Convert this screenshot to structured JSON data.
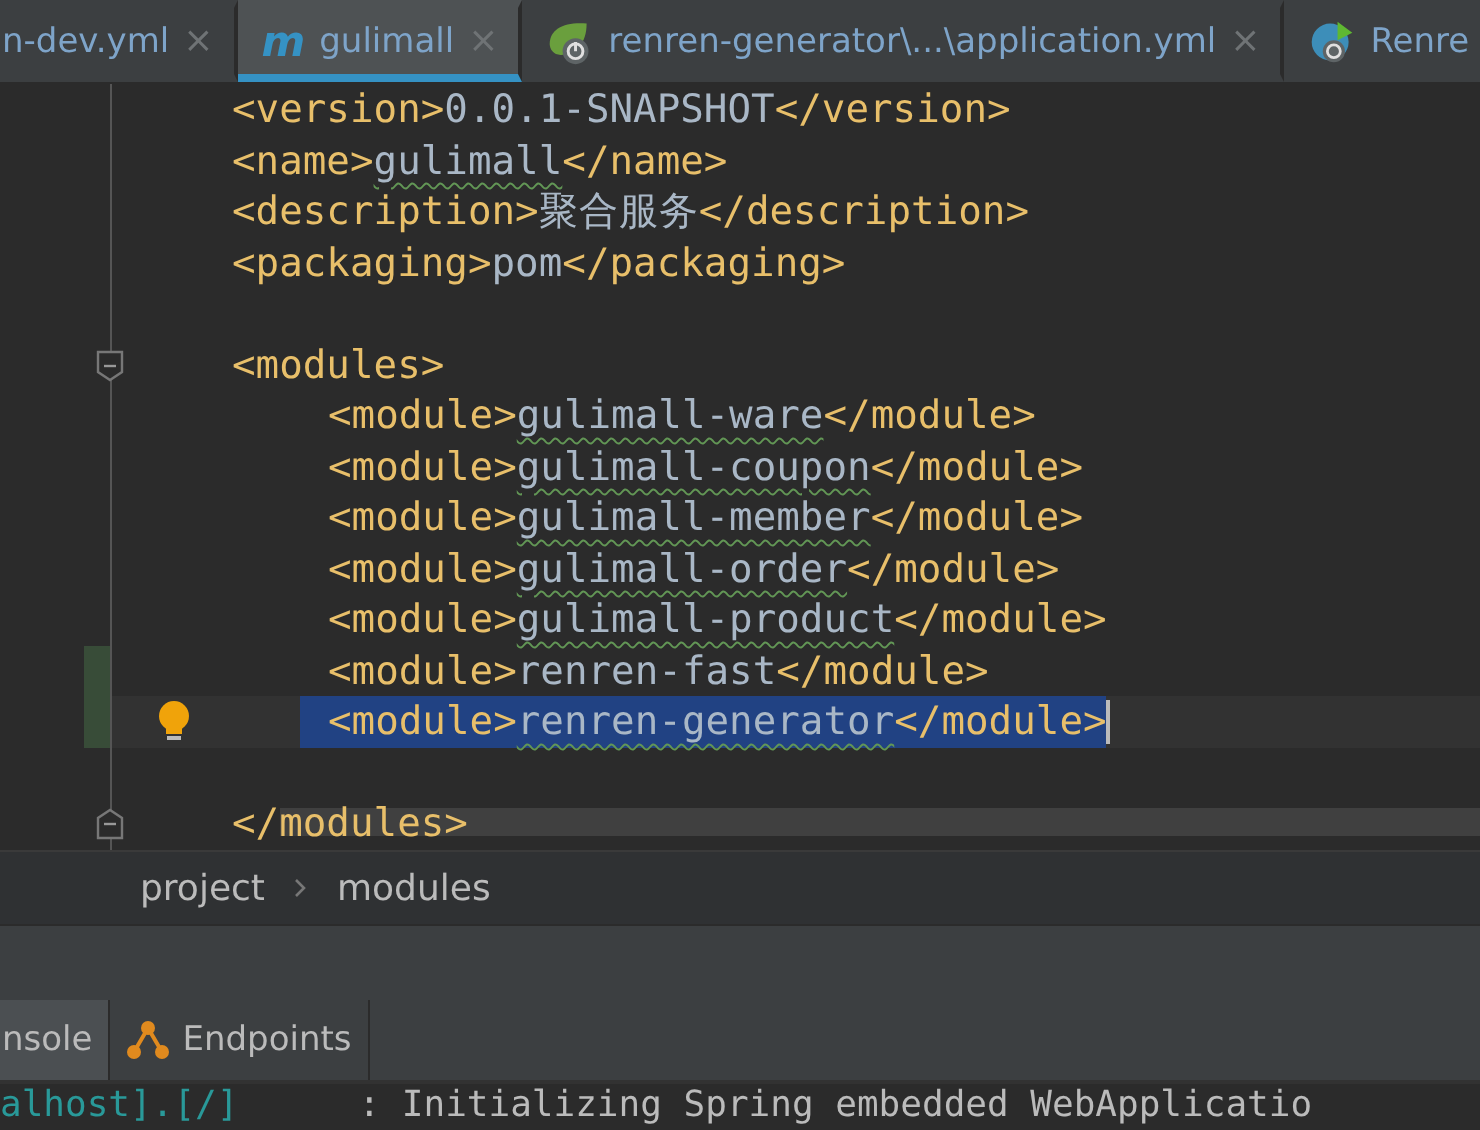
{
  "tabs": [
    {
      "label": "n-dev.yml",
      "kind": "plain",
      "close": "×",
      "selected": false
    },
    {
      "label": "gulimall",
      "kind": "maven",
      "badge": "m",
      "close": "×",
      "selected": true
    },
    {
      "label": "renren-generator\\...\\application.yml",
      "kind": "spring",
      "close": "×",
      "selected": false
    },
    {
      "label": "Renre",
      "kind": "springboot",
      "selected": false
    }
  ],
  "editor": {
    "lines": [
      {
        "open": "<version>",
        "value": "0.0.1-SNAPSHOT",
        "close": "</version>",
        "squiggle": false,
        "selected": false,
        "changed": false,
        "bulb": false
      },
      {
        "open": "<name>",
        "value": "gulimall",
        "close": "</name>",
        "squiggle": true,
        "selected": false,
        "changed": false,
        "bulb": false
      },
      {
        "open": "<description>",
        "value": "聚合服务",
        "close": "</description>",
        "squiggle": false,
        "selected": false,
        "changed": false,
        "bulb": false
      },
      {
        "open": "<packaging>",
        "value": "pom",
        "close": "</packaging>",
        "squiggle": false,
        "selected": false,
        "changed": false,
        "bulb": false
      },
      {
        "open": "<modules>",
        "close": "</modules>",
        "children": [
          {
            "open": "<module>",
            "value": "gulimall-ware",
            "close": "</module>",
            "squiggle": true,
            "selected": false,
            "changed": false,
            "bulb": false
          },
          {
            "open": "<module>",
            "value": "gulimall-coupon",
            "close": "</module>",
            "squiggle": true,
            "selected": false,
            "changed": false,
            "bulb": false
          },
          {
            "open": "<module>",
            "value": "gulimall-member",
            "close": "</module>",
            "squiggle": true,
            "selected": false,
            "changed": false,
            "bulb": false
          },
          {
            "open": "<module>",
            "value": "gulimall-order",
            "close": "</module>",
            "squiggle": true,
            "selected": false,
            "changed": false,
            "bulb": false
          },
          {
            "open": "<module>",
            "value": "gulimall-product",
            "close": "</module>",
            "squiggle": true,
            "selected": false,
            "changed": false,
            "bulb": false
          },
          {
            "open": "<module>",
            "value": "renren-fast",
            "close": "</module>",
            "squiggle": false,
            "selected": false,
            "changed": true,
            "bulb": false
          },
          {
            "open": "<module>",
            "value": "renren-generator",
            "close": "</module>",
            "squiggle": true,
            "selected": true,
            "changed": true,
            "bulb": true
          }
        ]
      }
    ]
  },
  "breadcrumb": [
    "project",
    "modules"
  ],
  "tool_tabs": [
    {
      "label": "nsole",
      "kind": "plain",
      "selected": true
    },
    {
      "label": "Endpoints",
      "kind": "endpoints",
      "selected": false
    }
  ],
  "console": {
    "logger": "alhost].[/]",
    "message": ": Initializing Spring embedded WebApplicatio"
  }
}
